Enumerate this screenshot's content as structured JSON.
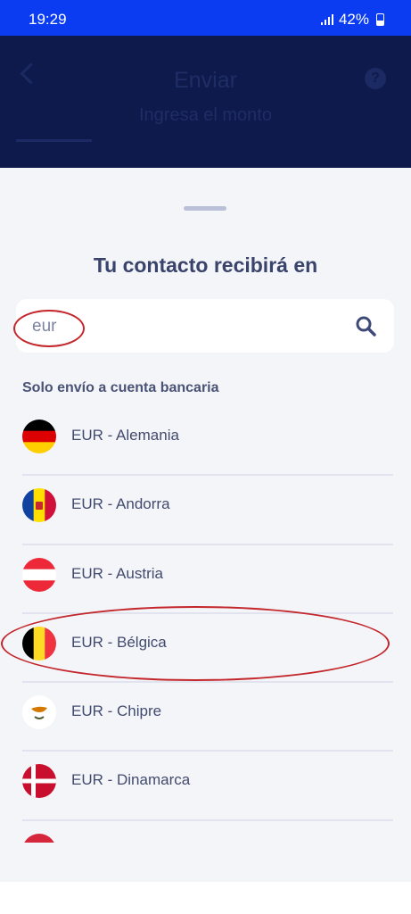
{
  "status_bar": {
    "time": "19:29",
    "battery": "42%"
  },
  "app_bar": {
    "title": "Enviar",
    "subtitle": "Ingresa el monto",
    "help_glyph": "?"
  },
  "sheet": {
    "title": "Tu contacto recibirá en",
    "search": {
      "value": "eur",
      "icon": "search-icon"
    },
    "section_label": "Solo envío a cuenta bancaria",
    "items": [
      {
        "label": "EUR - Alemania",
        "flag": "germany-flag-icon"
      },
      {
        "label": "EUR - Andorra",
        "flag": "andorra-flag-icon"
      },
      {
        "label": "EUR - Austria",
        "flag": "austria-flag-icon"
      },
      {
        "label": "EUR - Bélgica",
        "flag": "belgium-flag-icon"
      },
      {
        "label": "EUR - Chipre",
        "flag": "cyprus-flag-icon"
      },
      {
        "label": "EUR - Dinamarca",
        "flag": "denmark-flag-icon"
      }
    ]
  },
  "colors": {
    "status_bar": "#0b3cf2",
    "header_dimmed": "#0d1a4b",
    "sheet_bg": "#f4f5f9",
    "title_text": "#39436b",
    "annotation_red": "#c3262b"
  }
}
